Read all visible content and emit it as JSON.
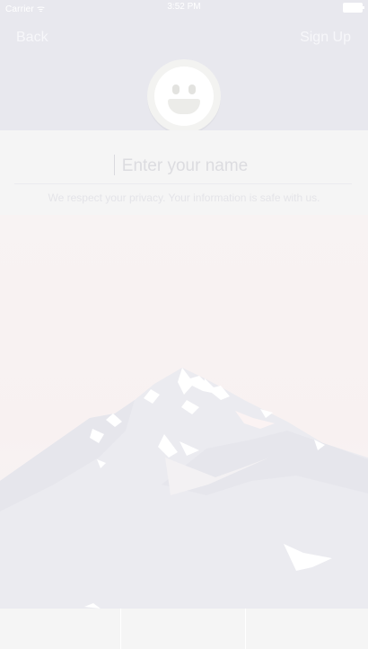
{
  "status_bar": {
    "carrier": "Carrier ᯤ",
    "time": "3:52 PM",
    "battery": "battery-full-icon"
  },
  "nav": {
    "back_label": "Back",
    "signup_label": "Sign Up"
  },
  "avatar": {
    "icon": "smiley-face-icon"
  },
  "form": {
    "name_placeholder": "Enter your name",
    "name_value": "",
    "privacy_text": "We respect your privacy. Your information is safe with us."
  },
  "scene": {
    "moon_icon": "crescent-moon-icon",
    "mountain": "mountain-illustration"
  },
  "bottom_bar": {
    "cells": [
      "",
      "",
      ""
    ]
  },
  "colors": {
    "top_bg": "#e8e8ee",
    "band_bg": "#f5f5f5",
    "sky": "#f8f2f2",
    "mountain": "#e9e9ef"
  }
}
